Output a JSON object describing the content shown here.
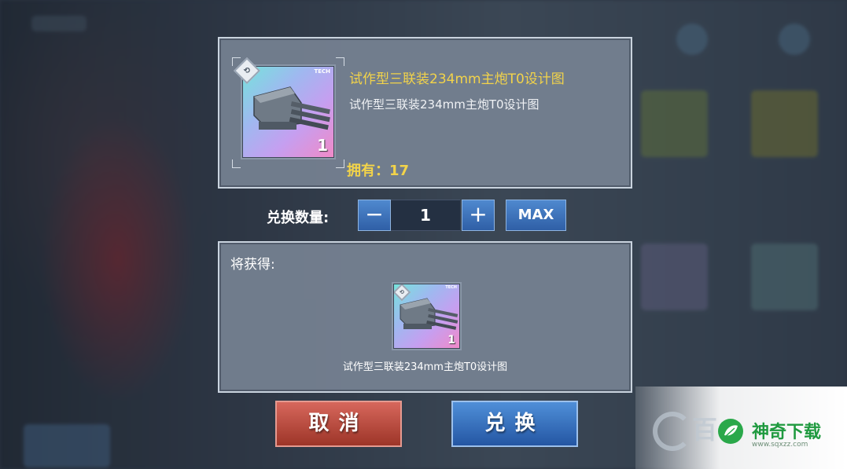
{
  "item": {
    "name": "试作型三联装234mm主炮T0设计图",
    "subtitle": "试作型三联装234mm主炮T0设计图",
    "card_tag": "TECH",
    "card_count": "1",
    "owned_label": "拥有：",
    "owned_value": "17"
  },
  "quantity": {
    "label": "兑换数量:",
    "minus": "−",
    "value": "1",
    "plus": "+",
    "max": "MAX"
  },
  "reward": {
    "label": "将获得:",
    "card_tag": "TECH",
    "card_count": "1",
    "name": "试作型三联装234mm主炮T0设计图"
  },
  "buttons": {
    "cancel": "取消",
    "exchange": "兑换"
  },
  "watermark": {
    "faint_text": "百",
    "name": "神奇下载",
    "url": "www.sqxzz.com"
  },
  "colors": {
    "accent_yellow": "#f2d34a",
    "button_blue": "#2f5fa6",
    "button_red": "#9d3528",
    "panel": "#76828f"
  }
}
